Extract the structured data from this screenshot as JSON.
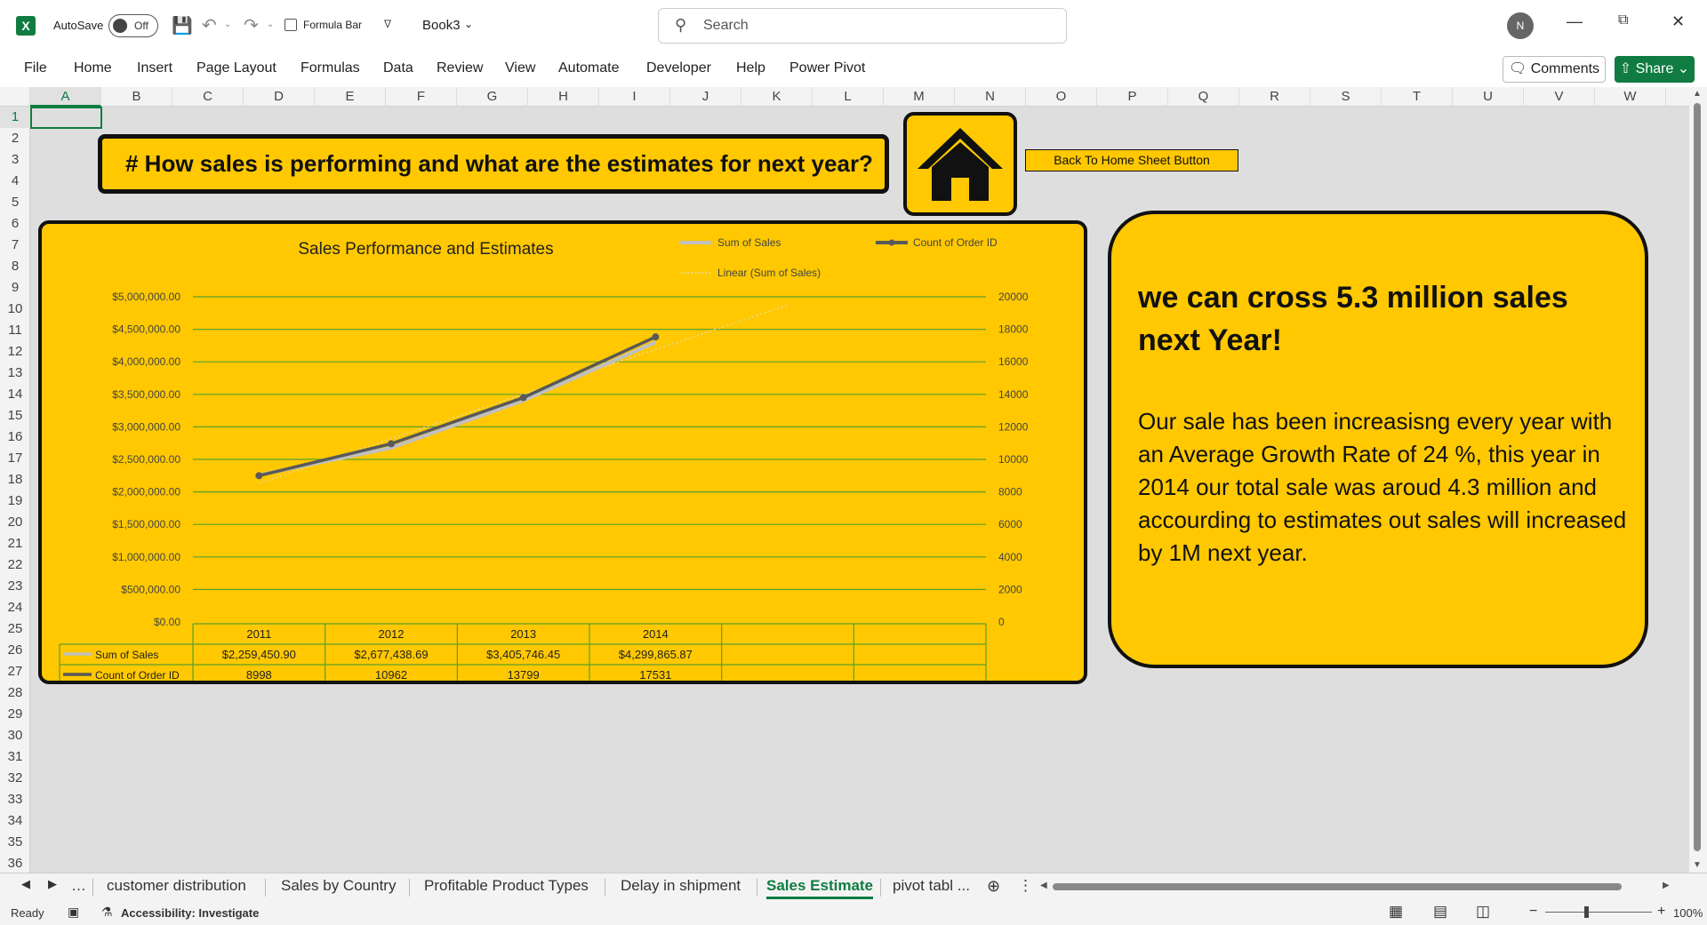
{
  "titlebar": {
    "autosave_label": "AutoSave",
    "autosave_state": "Off",
    "formula_bar_label": "Formula Bar",
    "workbook_name": "Book3",
    "search_placeholder": "Search",
    "user_initial": "N"
  },
  "menu": {
    "items": [
      "File",
      "Home",
      "Insert",
      "Page Layout",
      "Formulas",
      "Data",
      "Review",
      "View",
      "Automate",
      "Developer",
      "Help",
      "Power Pivot"
    ],
    "comments": "Comments",
    "share": "Share"
  },
  "columns": [
    "A",
    "B",
    "C",
    "D",
    "E",
    "F",
    "G",
    "H",
    "I",
    "J",
    "K",
    "L",
    "M",
    "N",
    "O",
    "P",
    "Q",
    "R",
    "S",
    "T",
    "U",
    "V",
    "W"
  ],
  "rows": [
    "1",
    "2",
    "3",
    "4",
    "5",
    "6",
    "7",
    "8",
    "9",
    "10",
    "11",
    "12",
    "13",
    "14",
    "15",
    "16",
    "17",
    "18",
    "19",
    "20",
    "21",
    "22",
    "23",
    "24",
    "25",
    "26",
    "27",
    "28",
    "29",
    "30",
    "31",
    "32",
    "33",
    "34",
    "35",
    "36"
  ],
  "sheet": {
    "title_text": "# How sales is performing and what are the estimates for next year?",
    "back_button": "Back To Home Sheet Button",
    "note_heading": "we can cross 5.3 million sales next Year!",
    "note_body": "Our sale has been increasisng every year with an Average Growth Rate of 24 %,  this year in 2014 our total sale was aroud 4.3 million and accourding to estimates out sales will increased by 1M next year."
  },
  "chart_data": {
    "type": "line",
    "title": "Sales Performance and Estimates",
    "categories": [
      "2011",
      "2012",
      "2013",
      "2014"
    ],
    "series": [
      {
        "name": "Sum of Sales",
        "axis": "left",
        "color": "#c0c0c0",
        "values": [
          2259450.9,
          2677438.69,
          3405746.45,
          4299865.87
        ],
        "labels": [
          "$2,259,450.90",
          "$2,677,438.69",
          "$3,405,746.45",
          "$4,299,865.87"
        ]
      },
      {
        "name": "Count of Order ID",
        "axis": "right",
        "color": "#595959",
        "values": [
          8998,
          10962,
          13799,
          17531
        ],
        "labels": [
          "8998",
          "10962",
          "13799",
          "17531"
        ]
      }
    ],
    "trendline": {
      "name": "Linear (Sum of Sales)",
      "of": "Sum of Sales",
      "extends_periods": 1
    },
    "y_left": {
      "min": 0,
      "max": 5000000,
      "step": 500000,
      "ticks": [
        "$0.00",
        "$500,000.00",
        "$1,000,000.00",
        "$1,500,000.00",
        "$2,000,000.00",
        "$2,500,000.00",
        "$3,000,000.00",
        "$3,500,000.00",
        "$4,000,000.00",
        "$4,500,000.00",
        "$5,000,000.00"
      ]
    },
    "y_right": {
      "min": 0,
      "max": 20000,
      "step": 2000,
      "ticks": [
        "0",
        "2000",
        "4000",
        "6000",
        "8000",
        "10000",
        "12000",
        "14000",
        "16000",
        "18000",
        "20000"
      ]
    },
    "grid": true,
    "legend_position": "top-right",
    "data_table": true,
    "colors": {
      "background": "#ffc800",
      "gridline": "#5aa02c"
    }
  },
  "sheet_tabs": {
    "items": [
      "customer distribution",
      "Sales by Country",
      "Profitable Product Types",
      "Delay in shipment",
      "Sales Estimate",
      "pivot tabl ..."
    ],
    "active": "Sales Estimate"
  },
  "status": {
    "ready": "Ready",
    "accessibility": "Accessibility: Investigate",
    "zoom": "100%"
  },
  "colors": {
    "excel_green": "#107c41",
    "highlight": "#ffc800"
  }
}
